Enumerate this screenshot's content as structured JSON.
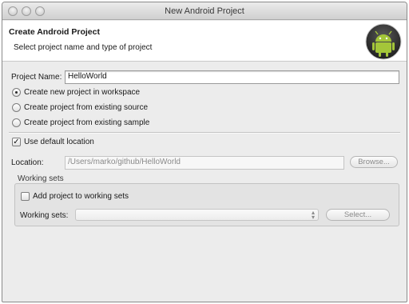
{
  "window": {
    "title": "New Android Project"
  },
  "banner": {
    "title": "Create Android Project",
    "subtitle": "Select project name and type of project"
  },
  "project_name": {
    "label": "Project Name:",
    "value": "HelloWorld"
  },
  "source_options": [
    {
      "label": "Create new project in workspace",
      "selected": true
    },
    {
      "label": "Create project from existing source",
      "selected": false
    },
    {
      "label": "Create project from existing sample",
      "selected": false
    }
  ],
  "default_location": {
    "label": "Use default location",
    "checked": true
  },
  "location": {
    "label": "Location:",
    "value": "/Users/marko/github/HelloWorld",
    "browse_label": "Browse..."
  },
  "working_sets": {
    "group_label": "Working sets",
    "add_label": "Add project to working sets",
    "add_checked": false,
    "select_label": "Working sets:",
    "selected_value": "",
    "select_button": "Select..."
  },
  "colors": {
    "android_green": "#a4c639",
    "window_bg": "#ececec"
  }
}
